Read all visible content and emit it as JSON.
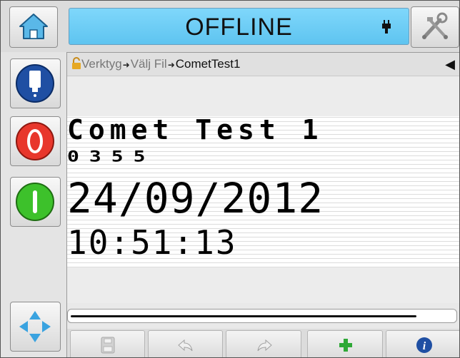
{
  "header": {
    "status": "OFFLINE",
    "home_icon": "home-icon",
    "tools_icon": "tools-icon",
    "status_indicator_icon": "ink-cartridge-icon"
  },
  "sidebar": {
    "items": [
      {
        "name": "ink-system-button",
        "icon": "ink-bottle-icon"
      },
      {
        "name": "stop-button",
        "icon": "stop-icon",
        "color": "#e8372c"
      },
      {
        "name": "start-button",
        "icon": "start-icon",
        "color": "#3dc12b"
      },
      {
        "name": "navigation-button",
        "icon": "navigation-arrows-icon"
      }
    ]
  },
  "breadcrumb": {
    "items": [
      "Verktyg",
      "Välj Fil",
      "CometTest1"
    ],
    "lock_icon": "lock-icon",
    "back_icon": "triangle-left-icon"
  },
  "print_preview": {
    "lines": [
      "Comet Test 1",
      "0355",
      "24/09/2012",
      "10:51:13"
    ]
  },
  "toolbar": {
    "buttons": [
      {
        "name": "save-button",
        "icon": "save-icon",
        "enabled": false
      },
      {
        "name": "undo-button",
        "icon": "undo-icon",
        "enabled": false
      },
      {
        "name": "redo-button",
        "icon": "redo-icon",
        "enabled": false
      },
      {
        "name": "add-button",
        "icon": "plus-icon",
        "enabled": true
      },
      {
        "name": "info-button",
        "icon": "info-icon",
        "enabled": true
      }
    ]
  },
  "colors": {
    "status_bar": "#5ec4f0",
    "stop": "#e8372c",
    "start": "#3dc12b",
    "add": "#2ea836",
    "info": "#1f4fa3"
  }
}
